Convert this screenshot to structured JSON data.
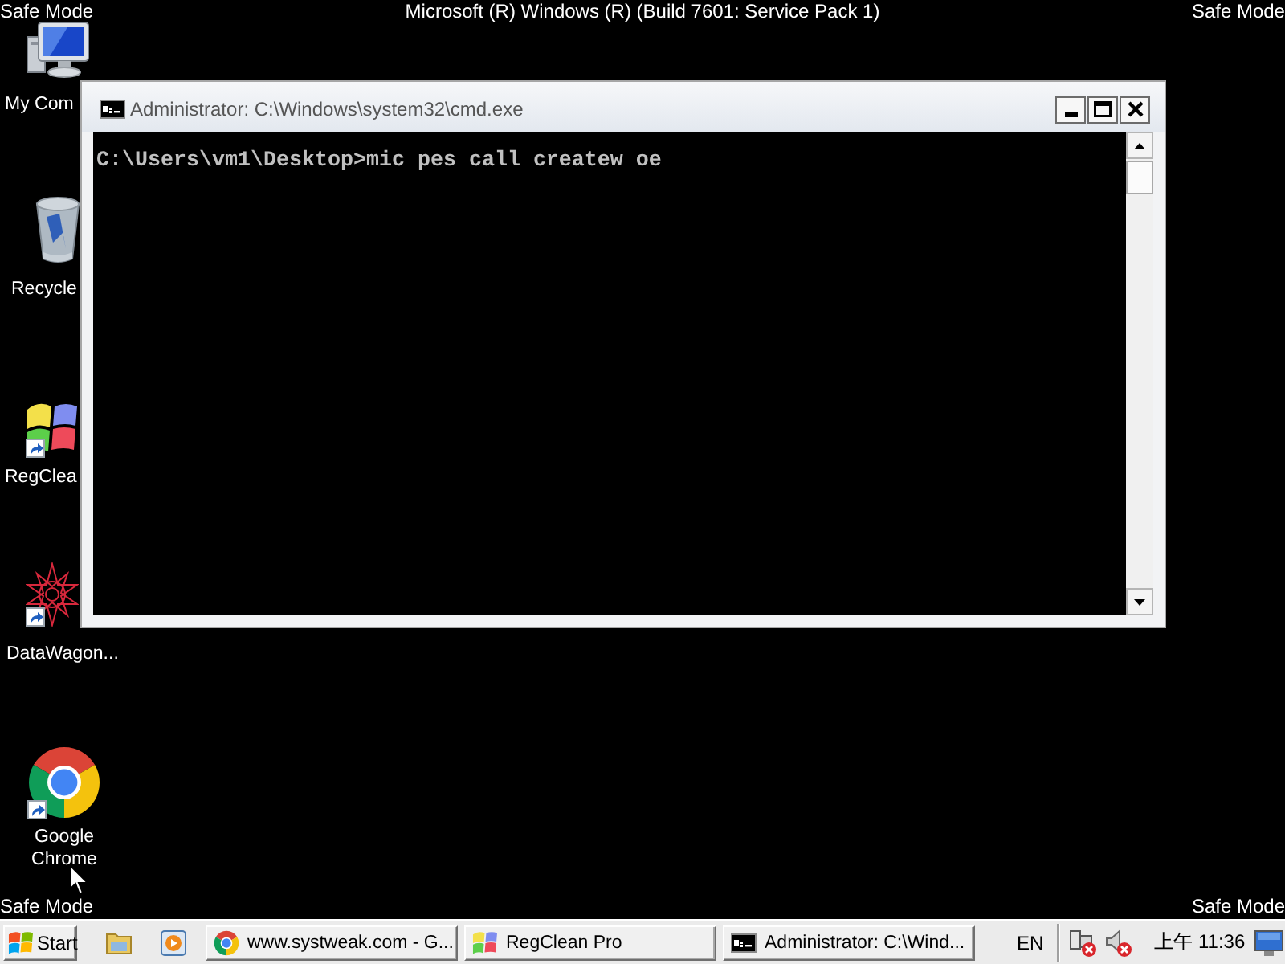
{
  "top_bar": {
    "left": "Safe Mode",
    "center": "Microsoft (R) Windows (R) (Build 7601: Service Pack 1)",
    "right": "Safe Mode"
  },
  "desktop_icons": [
    {
      "kind": "computer",
      "label": "My Com",
      "shortcut": false
    },
    {
      "kind": "recycle_bin",
      "label": "Recycle",
      "shortcut": false
    },
    {
      "kind": "flag",
      "label": "RegClea",
      "shortcut": true
    },
    {
      "kind": "star_pattern",
      "label": "DataWagon...",
      "shortcut": true
    },
    {
      "kind": "chrome",
      "label": "Google Chrome",
      "shortcut": true
    }
  ],
  "console_window": {
    "title": "Administrator: C:\\Windows\\system32\\cmd.exe",
    "lines": [
      "C:\\Users\\vm1\\Desktop>mic pes call createw oe"
    ]
  },
  "bottom_bar": {
    "left": "Safe Mode",
    "right": "Safe Mode"
  },
  "taskbar": {
    "start_label": "Start",
    "quick_launch": [
      {
        "kind": "folder"
      },
      {
        "kind": "play"
      }
    ],
    "buttons": [
      {
        "kind": "chrome",
        "label": "www.systweak.com - G..."
      },
      {
        "kind": "flag",
        "label": "RegClean Pro"
      },
      {
        "kind": "console",
        "label": "Administrator: C:\\Wind..."
      }
    ],
    "language": "EN",
    "tray_icons": [
      {
        "kind": "network"
      },
      {
        "kind": "volume"
      }
    ],
    "clock": "上午 11:36"
  }
}
